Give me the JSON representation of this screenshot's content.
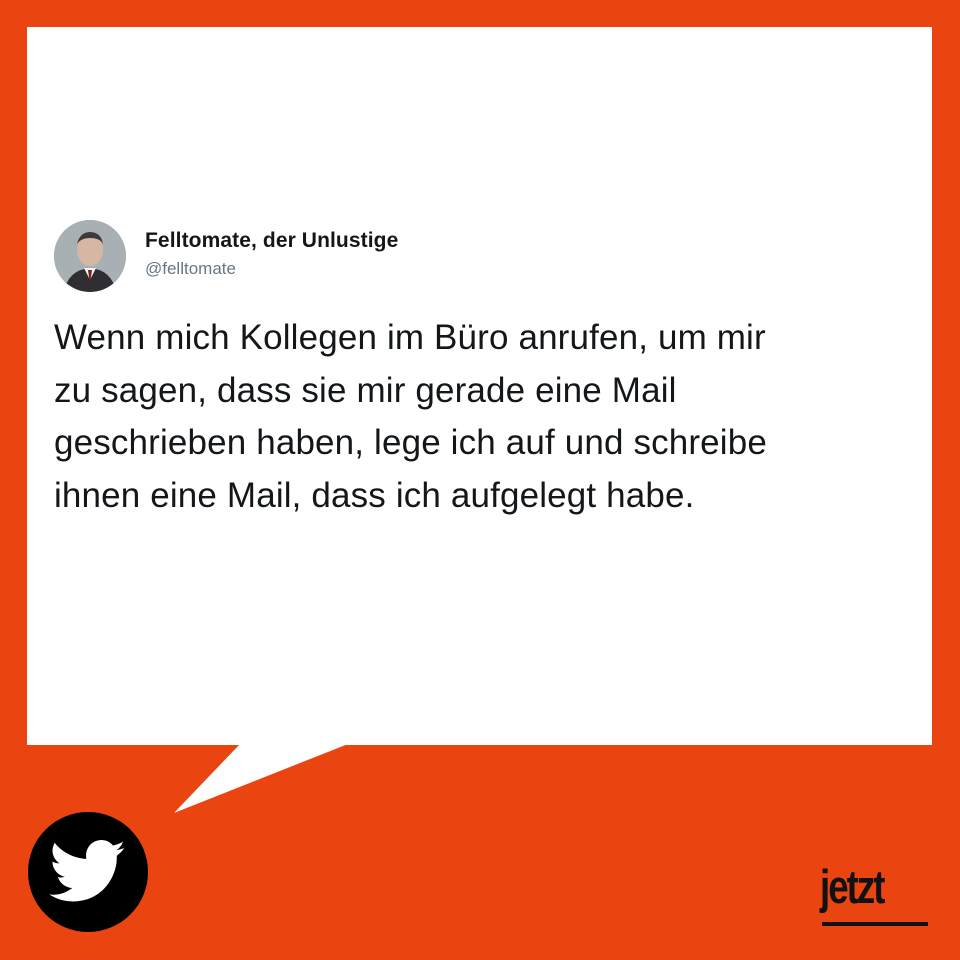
{
  "colors": {
    "background": "#ea4410",
    "bubble": "#ffffff",
    "text": "#14171a",
    "handle": "#657786",
    "badge": "#000000"
  },
  "tweet": {
    "display_name": "Felltomate, der Unlustige",
    "handle": "@felltomate",
    "text_lines": [
      "Wenn mich Kollegen im Büro anrufen, um mir",
      "zu sagen, dass sie mir gerade eine Mail",
      "geschrieben haben, lege ich auf und schreibe",
      "ihnen eine Mail, dass ich aufgelegt habe."
    ]
  },
  "branding": {
    "logo_text": "jetzt",
    "badge_icon": "twitter-bird-icon"
  }
}
